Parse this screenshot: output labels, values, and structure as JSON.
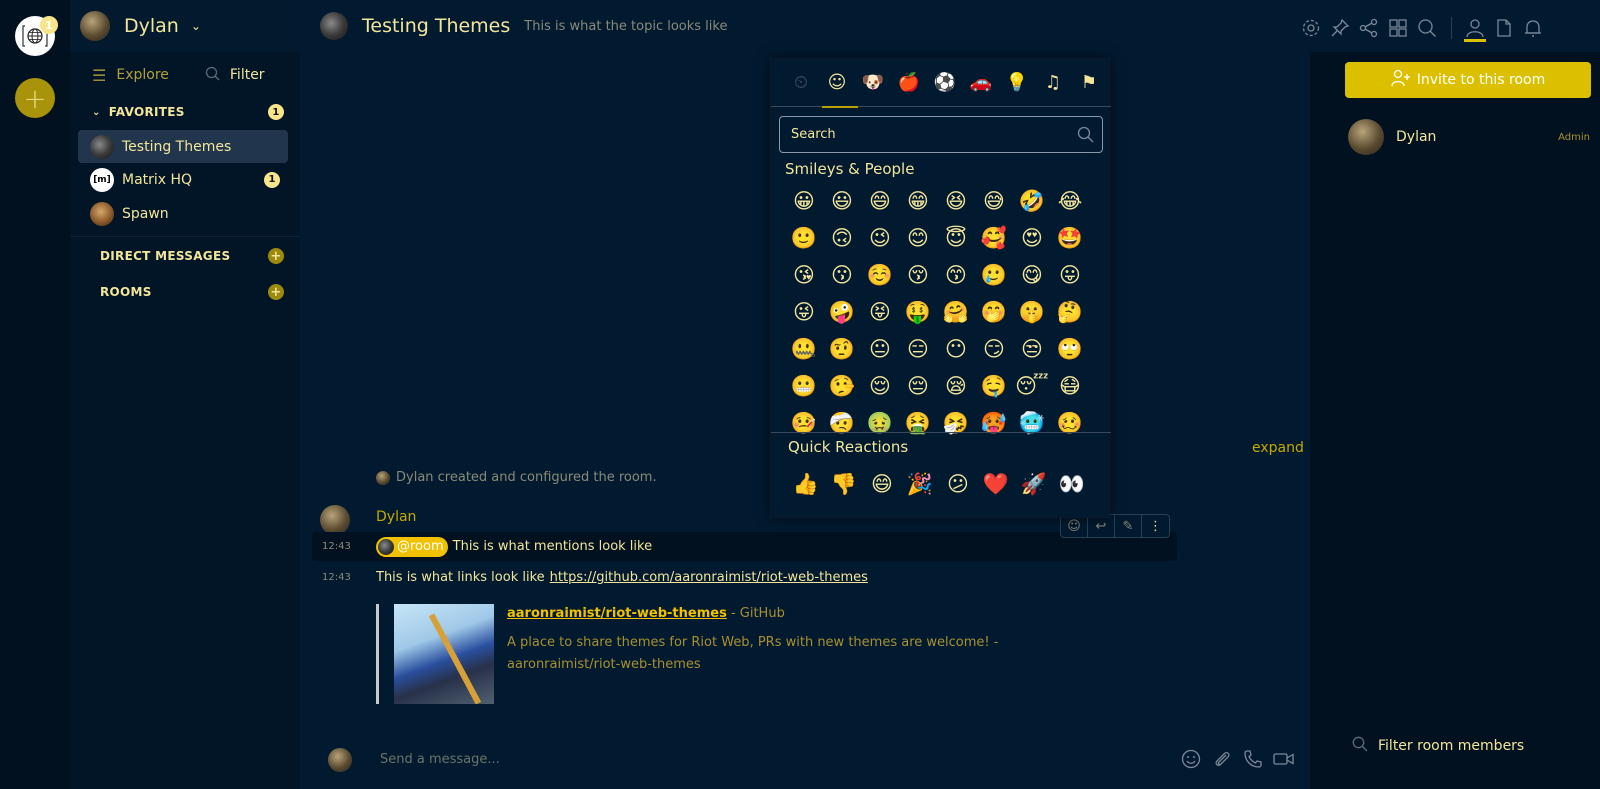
{
  "rail": {
    "home_badge": "1",
    "add_label": "+"
  },
  "sidebar": {
    "user_name": "Dylan",
    "explore_label": "Explore",
    "filter_label": "Filter",
    "favorites": {
      "label": "FAVORITES",
      "badge": "1",
      "rooms": [
        {
          "name": "Testing Themes",
          "active": true,
          "badge": ""
        },
        {
          "name": "Matrix HQ",
          "active": false,
          "badge": "1"
        },
        {
          "name": "Spawn",
          "active": false,
          "badge": ""
        }
      ]
    },
    "direct_messages_label": "DIRECT MESSAGES",
    "rooms_label": "ROOMS"
  },
  "room": {
    "title": "Testing Themes",
    "topic": "This is what the topic looks like"
  },
  "timeline": {
    "expand_label": "expand",
    "created_event": "Dylan created and configured the room.",
    "sender": "Dylan",
    "messages": [
      {
        "time": "12:43",
        "mention": "@room",
        "text": "This is what mentions look like"
      },
      {
        "time": "12:43",
        "text": "This is what links look like",
        "link": "https://github.com/aaronraimist/riot-web-themes"
      }
    ],
    "preview": {
      "title": "aaronraimist/riot-web-themes",
      "site": " - GitHub",
      "description": "A place to share themes for Riot Web, PRs with new themes are welcome! - aaronraimist/riot-web-themes"
    }
  },
  "composer": {
    "placeholder": "Send a message..."
  },
  "emoji_picker": {
    "categories": [
      {
        "name": "recent",
        "glyph": "⏲",
        "disabled": true
      },
      {
        "name": "smileys",
        "glyph": "☺",
        "active": true
      },
      {
        "name": "animals",
        "glyph": "🐶"
      },
      {
        "name": "food",
        "glyph": "🍎"
      },
      {
        "name": "activities",
        "glyph": "⚽"
      },
      {
        "name": "travel",
        "glyph": "🚗"
      },
      {
        "name": "objects",
        "glyph": "💡"
      },
      {
        "name": "symbols",
        "glyph": "♫"
      },
      {
        "name": "flags",
        "glyph": "⚑"
      }
    ],
    "search_placeholder": "Search",
    "section_title": "Smileys & People",
    "emojis": [
      "😀",
      "😃",
      "😄",
      "😁",
      "😆",
      "😅",
      "🤣",
      "😂",
      "🙂",
      "🙃",
      "😉",
      "😊",
      "😇",
      "🥰",
      "😍",
      "🤩",
      "😘",
      "😗",
      "☺️",
      "😚",
      "😙",
      "🥲",
      "😋",
      "😛",
      "😜",
      "🤪",
      "😝",
      "🤑",
      "🤗",
      "🤭",
      "🤫",
      "🤔",
      "🤐",
      "🤨",
      "😐",
      "😑",
      "😶",
      "😏",
      "😒",
      "🙄",
      "😬",
      "🤥",
      "😌",
      "😔",
      "😪",
      "🤤",
      "😴",
      "😷",
      "🤒",
      "🤕",
      "🤢",
      "🤮",
      "🤧",
      "🥵",
      "🥶",
      "🥴"
    ],
    "quick_reactions_title": "Quick Reactions",
    "quick_reactions": [
      "👍",
      "👎",
      "😄",
      "🎉",
      "😕",
      "❤️",
      "🚀",
      "👀"
    ]
  },
  "right_panel": {
    "invite_label": "Invite to this room",
    "members": [
      {
        "name": "Dylan",
        "role": "Admin"
      }
    ],
    "filter_placeholder": "Filter room members"
  }
}
